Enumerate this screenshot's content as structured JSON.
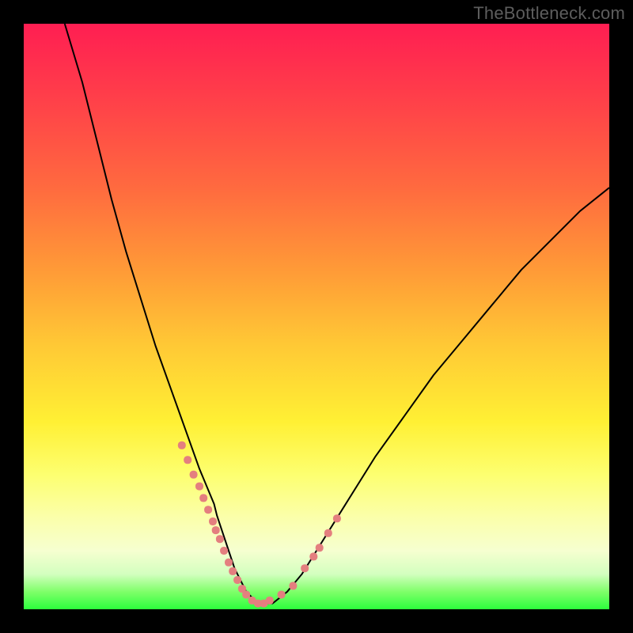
{
  "watermark": {
    "text": "TheBottleneck.com"
  },
  "colors": {
    "frame": "#000000",
    "curve": "#000000",
    "markers": "#e47f7f",
    "gradient_top": "#ff1e52",
    "gradient_bottom": "#2cff3c"
  },
  "chart_data": {
    "type": "line",
    "title": "",
    "xlabel": "",
    "ylabel": "",
    "xlim": [
      0,
      100
    ],
    "ylim": [
      0,
      100
    ],
    "grid": false,
    "legend": false,
    "annotations": [],
    "series": [
      {
        "name": "curve",
        "stroke": "#000000",
        "x": [
          7,
          10,
          12.5,
          15,
          17.5,
          20,
          22.5,
          25,
          27.5,
          30,
          32.5,
          33,
          34,
          35,
          36,
          37,
          38,
          40,
          42.5,
          45,
          47.5,
          50,
          55,
          60,
          65,
          70,
          75,
          80,
          85,
          90,
          95,
          100
        ],
        "y": [
          100,
          90,
          80,
          70,
          61,
          53,
          45,
          38,
          31,
          24,
          18,
          16,
          13,
          10,
          7,
          5,
          3,
          1,
          1,
          3,
          6,
          10,
          18,
          26,
          33,
          40,
          46,
          52,
          58,
          63,
          68,
          72
        ]
      },
      {
        "name": "markers",
        "type": "scatter",
        "marker_color": "#e47f7f",
        "marker_shape": "rounded-square",
        "marker_size": 10,
        "x": [
          27,
          28,
          29,
          30,
          30.7,
          31.5,
          32.3,
          32.8,
          33.5,
          34.2,
          35,
          35.7,
          36.5,
          37.3,
          38,
          39,
          40,
          41,
          42,
          44,
          46,
          48,
          49.5,
          50.5,
          52,
          53.5
        ],
        "y": [
          28,
          25.5,
          23,
          21,
          19,
          17,
          15,
          13.5,
          12,
          10,
          8,
          6.5,
          5,
          3.5,
          2.5,
          1.5,
          1,
          1,
          1.5,
          2.5,
          4,
          7,
          9,
          10.5,
          13,
          15.5
        ]
      }
    ]
  }
}
